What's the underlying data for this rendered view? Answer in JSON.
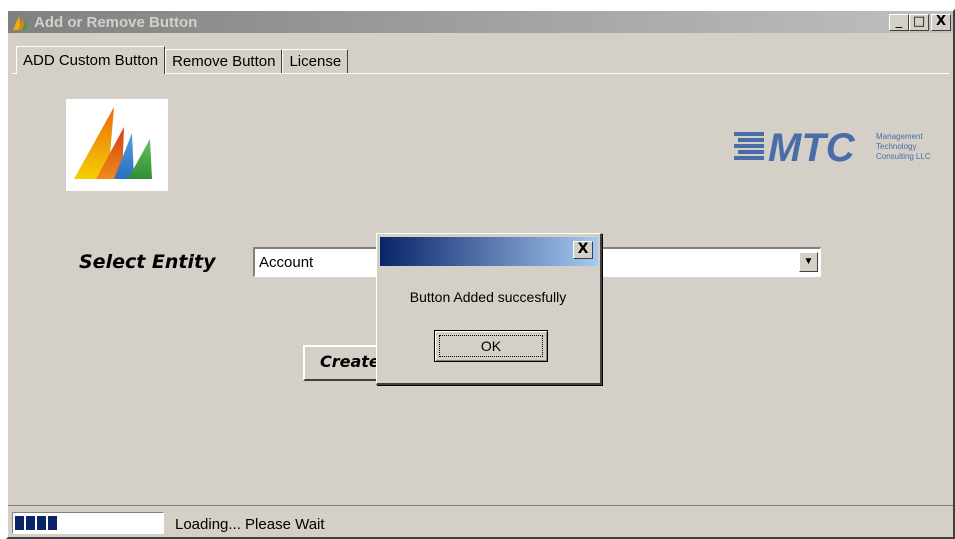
{
  "window": {
    "title": "Add or Remove Button",
    "controls": {
      "minimize": "_",
      "maximize": "□",
      "close": "X"
    }
  },
  "tabs": [
    {
      "label": "ADD Custom Button",
      "active": true
    },
    {
      "label": "Remove Button",
      "active": false
    },
    {
      "label": "License",
      "active": false
    }
  ],
  "branding": {
    "mtc_letters": "MTC",
    "mtc_line1": "Management",
    "mtc_line2": "Technology",
    "mtc_line3": "Consulting LLC"
  },
  "form": {
    "select_label": "Select Entity",
    "entity_value": "Account",
    "create_button_label": "Create"
  },
  "status": {
    "progress_fraction": 0.3,
    "text": "Loading... Please Wait"
  },
  "dialog": {
    "title": "",
    "message": "Button Added succesfully",
    "ok_label": "OK",
    "close": "X"
  },
  "colors": {
    "face": "#d4d0c8",
    "title_active_start": "#0a246a",
    "title_active_end": "#a6caf0",
    "mtc_blue": "#4a6ca8"
  }
}
